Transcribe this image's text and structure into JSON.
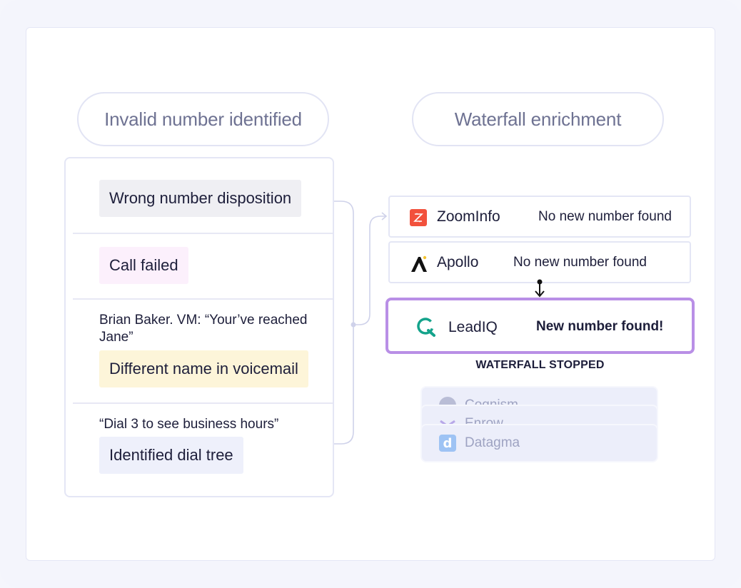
{
  "headers": {
    "left": "Invalid number identified",
    "right": "Waterfall enrichment"
  },
  "signals": [
    {
      "quote": "",
      "tag": "Wrong number disposition",
      "tag_color": "#efeff3"
    },
    {
      "quote": "",
      "tag": "Call failed",
      "tag_color": "#fcf0fc"
    },
    {
      "quote": "Brian Baker. VM: “Your’ve reached Jane”",
      "tag": "Different name in voicemail",
      "tag_color": "#fdf5d9"
    },
    {
      "quote": "“Dial 3 to see business hours”",
      "tag": "Identified dial tree",
      "tag_color": "#eef0fb"
    }
  ],
  "providers": [
    {
      "name": "ZoomInfo",
      "status": "No new number found",
      "icon": "zoominfo-logo-icon"
    },
    {
      "name": "Apollo",
      "status": "No new number found",
      "icon": "apollo-logo-icon"
    },
    {
      "name": "LeadIQ",
      "status": "New number found!",
      "icon": "leadiq-logo-icon"
    }
  ],
  "waterfall_status": "WATERFALL STOPPED",
  "remaining_providers": [
    {
      "name": "Cognism",
      "icon": "cognism-logo-icon"
    },
    {
      "name": "Enrow",
      "icon": "enrow-logo-icon"
    },
    {
      "name": "Datagma",
      "icon": "datagma-logo-icon"
    }
  ],
  "colors": {
    "accent_purple": "#b98fe6",
    "zoominfo_red": "#f2513c",
    "leadiq_teal": "#14a38b",
    "connector": "#cfd2ea"
  }
}
